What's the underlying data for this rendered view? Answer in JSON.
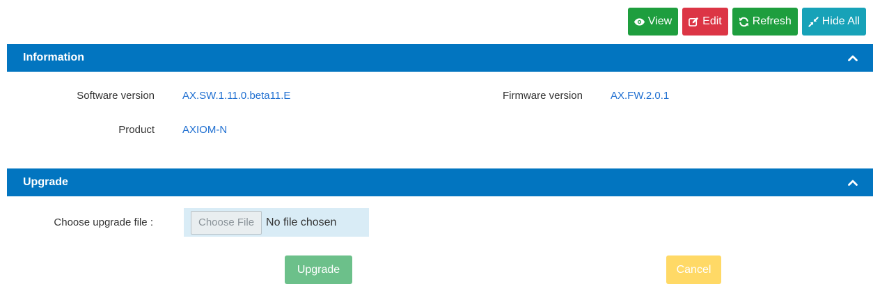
{
  "toolbar": {
    "view_label": "View",
    "edit_label": "Edit",
    "refresh_label": "Refresh",
    "hide_all_label": "Hide All",
    "icons": {
      "view": "eye-icon",
      "edit": "pencil-square-icon",
      "refresh": "refresh-icon",
      "hide_all": "compress-icon"
    }
  },
  "information": {
    "title": "Information",
    "collapse_icon": "chevron-up-icon",
    "software_version_label": "Software version",
    "software_version": "AX.SW.1.11.0.beta11.E",
    "firmware_version_label": "Firmware version",
    "firmware_version": "AX.FW.2.0.1",
    "product_label": "Product",
    "product": "AXIOM-N"
  },
  "upgrade": {
    "title": "Upgrade",
    "collapse_icon": "chevron-up-icon",
    "choose_file_label": "Choose upgrade file :",
    "choose_file_button": "Choose File",
    "file_status": "No file chosen",
    "upgrade_button": "Upgrade",
    "cancel_button": "Cancel"
  },
  "colors": {
    "header": "#0275c0",
    "view": "#1e9e3e",
    "edit": "#dc3545",
    "refresh": "#1e9e3e",
    "hide_all": "#17a2b8",
    "upgrade": "#6cc08a",
    "cancel": "#ffd966",
    "link_value": "#1f6fd1"
  }
}
